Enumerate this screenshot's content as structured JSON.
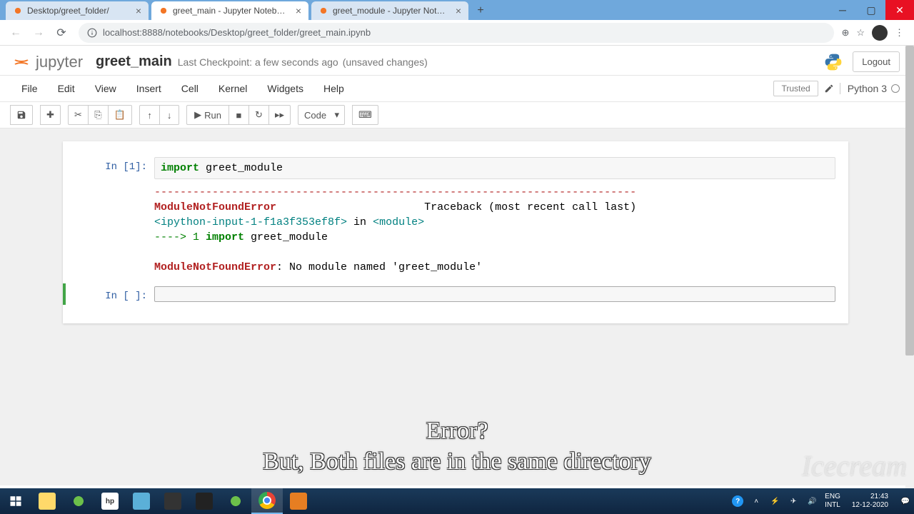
{
  "window": {
    "url": "localhost:8888/notebooks/Desktop/greet_folder/greet_main.ipynb"
  },
  "tabs": [
    {
      "title": "Desktop/greet_folder/"
    },
    {
      "title": "greet_main - Jupyter Notebook"
    },
    {
      "title": "greet_module - Jupyter Notebo"
    }
  ],
  "notebook": {
    "logo_text": "jupyter",
    "name": "greet_main",
    "checkpoint_prefix": "Last Checkpoint: ",
    "checkpoint_time": "a few seconds ago",
    "unsaved": "(unsaved changes)",
    "logout": "Logout",
    "trusted": "Trusted",
    "kernel": "Python 3"
  },
  "menus": [
    "File",
    "Edit",
    "View",
    "Insert",
    "Cell",
    "Kernel",
    "Widgets",
    "Help"
  ],
  "toolbar": {
    "run": "Run",
    "celltype": "Code"
  },
  "cells": [
    {
      "prompt": "In [1]:",
      "code_kw": "import",
      "code_rest": " greet_module",
      "output": {
        "sep": "---------------------------------------------------------------------------",
        "err_name": "ModuleNotFoundError",
        "traceback_label": "Traceback (most recent call last)",
        "loc_pre": "<ipython-input-1-f1a3f353ef8f>",
        "loc_in": " in ",
        "loc_mod": "<module>",
        "arrow": "----> 1 ",
        "arrow_kw": "import",
        "arrow_rest": " greet_module",
        "final_err": "ModuleNotFoundError",
        "final_msg": ": No module named 'greet_module'"
      }
    },
    {
      "prompt": "In [ ]:"
    }
  ],
  "overlay": {
    "line1": "Error?",
    "line2": "But, Both files are in the same directory",
    "watermark": "Icecream"
  },
  "tray": {
    "lang1": "ENG",
    "lang2": "INTL",
    "time": "21:43",
    "date": "12-12-2020"
  }
}
